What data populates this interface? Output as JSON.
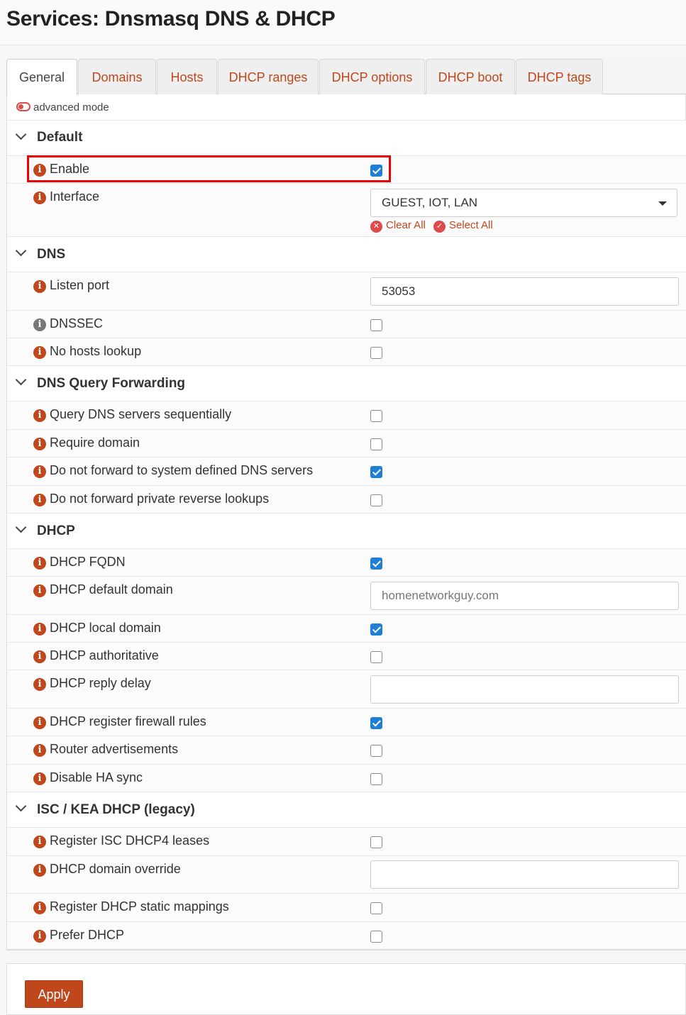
{
  "page": {
    "title": "Services: Dnsmasq DNS & DHCP"
  },
  "tabs": [
    {
      "label": "General",
      "active": true
    },
    {
      "label": "Domains"
    },
    {
      "label": "Hosts"
    },
    {
      "label": "DHCP ranges"
    },
    {
      "label": "DHCP options"
    },
    {
      "label": "DHCP boot"
    },
    {
      "label": "DHCP tags"
    }
  ],
  "advanced_mode": {
    "label": "advanced mode",
    "enabled": false
  },
  "sections": {
    "default": {
      "title": "Default",
      "enable": {
        "label": "Enable",
        "checked": true
      },
      "interface": {
        "label": "Interface",
        "value": "GUEST, IOT, LAN",
        "clear_all": "Clear All",
        "select_all": "Select All"
      }
    },
    "dns": {
      "title": "DNS",
      "listen_port": {
        "label": "Listen port",
        "value": "53053"
      },
      "dnssec": {
        "label": "DNSSEC",
        "checked": false
      },
      "no_hosts_lookup": {
        "label": "No hosts lookup",
        "checked": false
      }
    },
    "dns_forwarding": {
      "title": "DNS Query Forwarding",
      "query_sequential": {
        "label": "Query DNS servers sequentially",
        "checked": false
      },
      "require_domain": {
        "label": "Require domain",
        "checked": false
      },
      "no_forward_system": {
        "label": "Do not forward to system defined DNS servers",
        "checked": true
      },
      "no_forward_private": {
        "label": "Do not forward private reverse lookups",
        "checked": false
      }
    },
    "dhcp": {
      "title": "DHCP",
      "fqdn": {
        "label": "DHCP FQDN",
        "checked": true
      },
      "default_domain": {
        "label": "DHCP default domain",
        "placeholder": "homenetworkguy.com"
      },
      "local_domain": {
        "label": "DHCP local domain",
        "checked": true
      },
      "authoritative": {
        "label": "DHCP authoritative",
        "checked": false
      },
      "reply_delay": {
        "label": "DHCP reply delay",
        "value": ""
      },
      "register_fw_rules": {
        "label": "DHCP register firewall rules",
        "checked": true
      },
      "router_adv": {
        "label": "Router advertisements",
        "checked": false
      },
      "disable_ha_sync": {
        "label": "Disable HA sync",
        "checked": false
      }
    },
    "legacy": {
      "title": "ISC / KEA DHCP (legacy)",
      "register_isc4": {
        "label": "Register ISC DHCP4 leases",
        "checked": false
      },
      "domain_override": {
        "label": "DHCP domain override",
        "value": ""
      },
      "register_static": {
        "label": "Register DHCP static mappings",
        "checked": false
      },
      "prefer_dhcp": {
        "label": "Prefer DHCP",
        "checked": false
      }
    }
  },
  "actions": {
    "apply": "Apply"
  },
  "colors": {
    "accent": "#c0471b",
    "checkbox_on": "#1f7fd4",
    "highlight": "#ee0000"
  }
}
